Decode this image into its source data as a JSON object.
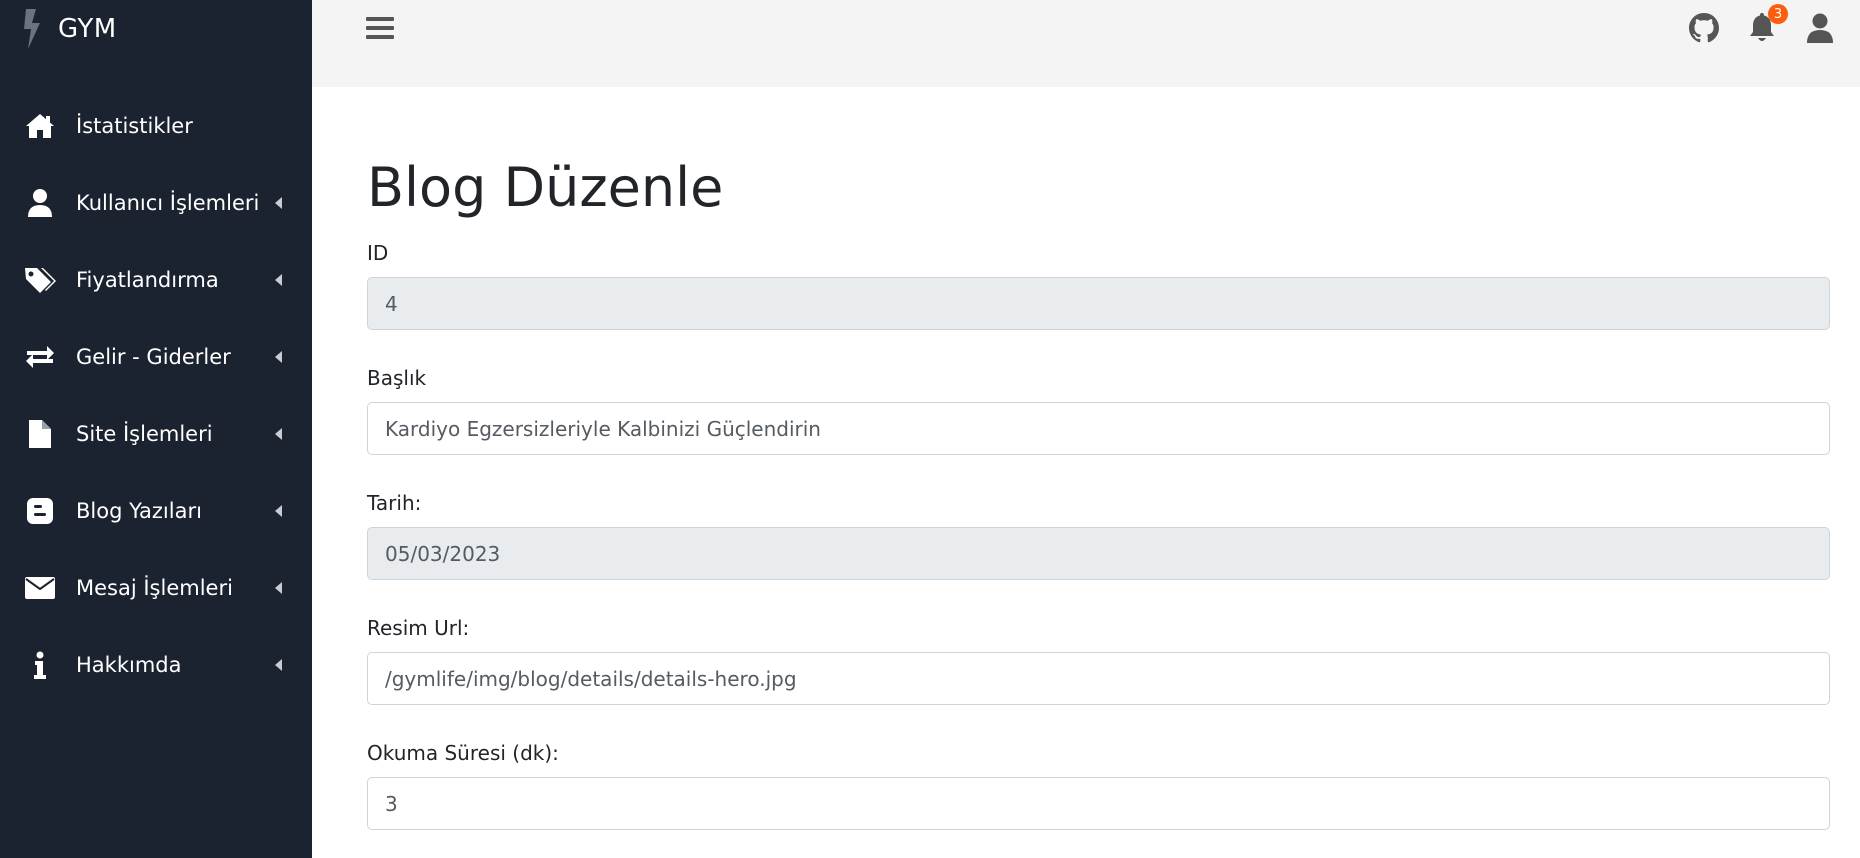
{
  "brand": {
    "name": "GYM",
    "logo_icon": "bolt-icon"
  },
  "sidebar": {
    "items": [
      {
        "label": "İstatistikler",
        "icon": "home-icon",
        "has_submenu": false
      },
      {
        "label": "Kullanıcı İşlemleri",
        "icon": "user-icon",
        "has_submenu": true
      },
      {
        "label": "Fiyatlandırma",
        "icon": "tags-icon",
        "has_submenu": true
      },
      {
        "label": "Gelir - Giderler",
        "icon": "exchange-arrows-icon",
        "has_submenu": true
      },
      {
        "label": "Site İşlemleri",
        "icon": "file-icon",
        "has_submenu": true
      },
      {
        "label": "Blog Yazıları",
        "icon": "blogger-icon",
        "has_submenu": true
      },
      {
        "label": "Mesaj İşlemleri",
        "icon": "envelope-icon",
        "has_submenu": true
      },
      {
        "label": "Hakkımda",
        "icon": "info-icon",
        "has_submenu": true
      }
    ]
  },
  "topbar": {
    "menu_icon": "hamburger-icon",
    "github_icon": "github-icon",
    "bell_icon": "bell-icon",
    "notification_count": "3",
    "user_icon": "user-icon"
  },
  "page": {
    "title": "Blog Düzenle"
  },
  "form": {
    "id": {
      "label": "ID",
      "value": "4",
      "readonly": true
    },
    "title": {
      "label": "Başlık",
      "value": "Kardiyo Egzersizleriyle Kalbinizi Güçlendirin",
      "readonly": false
    },
    "date": {
      "label": "Tarih:",
      "value": "05/03/2023",
      "readonly": true
    },
    "image_url": {
      "label": "Resim Url:",
      "value": "/gymlife/img/blog/details/details-hero.jpg",
      "readonly": false
    },
    "read_time": {
      "label": "Okuma Süresi (dk):",
      "value": "3",
      "readonly": false
    }
  },
  "colors": {
    "sidebar_bg": "#1b2230",
    "topbar_bg": "#f4f4f4",
    "readonly_input_bg": "#e9ecef",
    "badge_bg": "#fd5d0d"
  }
}
